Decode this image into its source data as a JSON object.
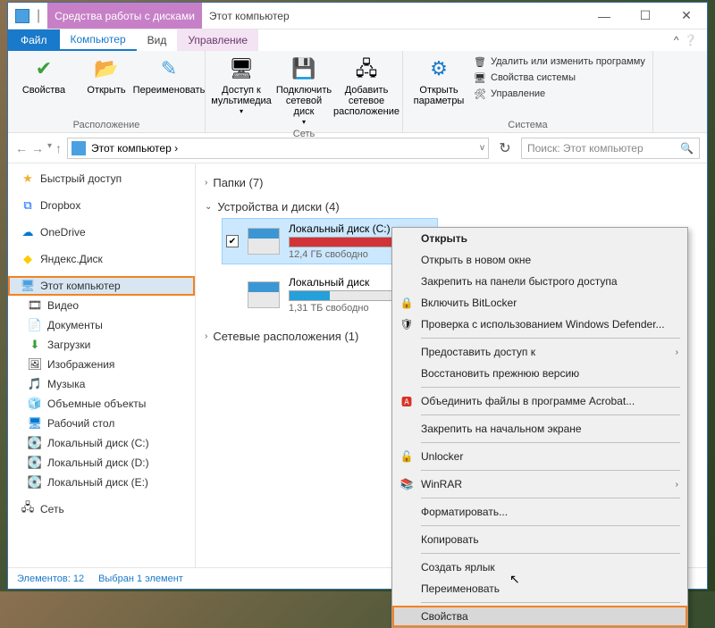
{
  "window": {
    "contextual_header": "Средства работы с дисками",
    "caption": "Этот компьютер",
    "buttons": {
      "min": "—",
      "max": "☐",
      "close": "✕"
    }
  },
  "tabs": {
    "file": "Файл",
    "computer": "Компьютер",
    "view": "Вид",
    "manage": "Управление"
  },
  "ribbon": {
    "location": {
      "label": "Расположение",
      "properties": "Свойства",
      "open": "Открыть",
      "rename": "Переименовать"
    },
    "network": {
      "label": "Сеть",
      "media_access": "Доступ к мультимедиа",
      "map_drive": "Подключить сетевой диск",
      "add_network": "Добавить сетевое расположение"
    },
    "system": {
      "label": "Система",
      "open_settings": "Открыть параметры",
      "uninstall": "Удалить или изменить программу",
      "sys_props": "Свойства системы",
      "manage": "Управление"
    }
  },
  "address": {
    "path": "Этот компьютер ›",
    "search_placeholder": "Поиск: Этот компьютер"
  },
  "sidebar": {
    "quick_access": "Быстрый доступ",
    "dropbox": "Dropbox",
    "onedrive": "OneDrive",
    "yandex": "Яндекс.Диск",
    "this_pc": "Этот компьютер",
    "video": "Видео",
    "documents": "Документы",
    "downloads": "Загрузки",
    "pictures": "Изображения",
    "music": "Музыка",
    "objects3d": "Объемные объекты",
    "desktop": "Рабочий стол",
    "disk_c": "Локальный диск (C:)",
    "disk_d": "Локальный диск (D:)",
    "disk_e": "Локальный диск (E:)",
    "network": "Сеть"
  },
  "content": {
    "folders_header": "Папки (7)",
    "drives_header": "Устройства и диски (4)",
    "network_header": "Сетевые расположения (1)",
    "drive_c": {
      "name": "Локальный диск (C:)",
      "free": "12,4 ГБ свободно"
    },
    "drive_d": {
      "name": "Локальный диск (D:)"
    },
    "drive_c2": {
      "name": "Локальный диск",
      "free": "1,31 ТБ свободно"
    }
  },
  "context_menu": {
    "open": "Открыть",
    "open_new": "Открыть в новом окне",
    "pin_quick": "Закрепить на панели быстрого доступа",
    "bitlocker": "Включить BitLocker",
    "defender": "Проверка с использованием Windows Defender...",
    "grant_access": "Предоставить доступ к",
    "restore": "Восстановить прежнюю версию",
    "acrobat": "Объединить файлы в программе Acrobat...",
    "pin_start": "Закрепить на начальном экране",
    "unlocker": "Unlocker",
    "winrar": "WinRAR",
    "format": "Форматировать...",
    "copy": "Копировать",
    "shortcut": "Создать ярлык",
    "rename": "Переименовать",
    "properties": "Свойства"
  },
  "statusbar": {
    "count": "Элементов: 12",
    "selected": "Выбран 1 элемент"
  }
}
